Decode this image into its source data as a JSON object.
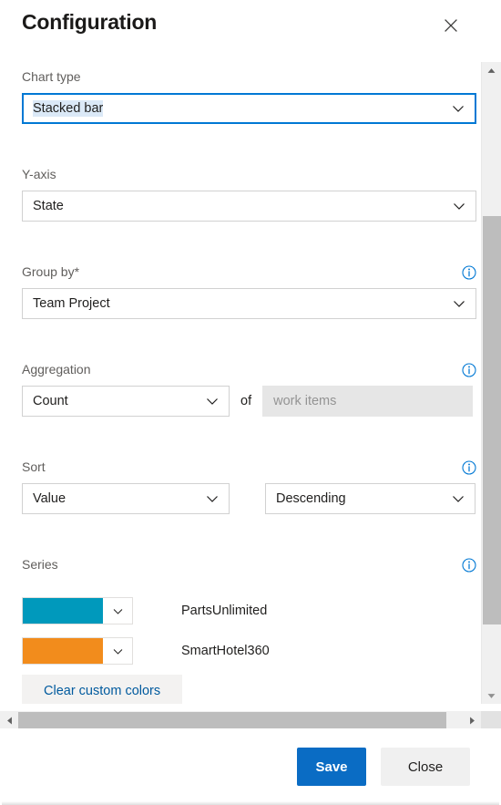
{
  "dialog": {
    "title": "Configuration",
    "close_icon": "close-icon",
    "close_label": "Close"
  },
  "fields": {
    "chart_type": {
      "label": "Chart type",
      "value": "Stacked bar",
      "chevron_icon": "chevron-down-icon",
      "focused": true
    },
    "y_axis": {
      "label": "Y-axis",
      "value": "State",
      "chevron_icon": "chevron-down-icon"
    },
    "group_by": {
      "label": "Group by*",
      "value": "Team Project",
      "chevron_icon": "chevron-down-icon",
      "info_icon": "info-icon"
    },
    "aggregation": {
      "label": "Aggregation",
      "value": "Count",
      "chevron_icon": "chevron-down-icon",
      "info_icon": "info-icon",
      "of_label": "of",
      "target_placeholder": "work items",
      "target_value": ""
    },
    "sort": {
      "label": "Sort",
      "info_icon": "info-icon",
      "by_value": "Value",
      "direction_value": "Descending",
      "chevron_icon": "chevron-down-icon"
    },
    "series": {
      "label": "Series",
      "info_icon": "info-icon",
      "items": [
        {
          "name": "PartsUnlimited",
          "color": "#0099BC",
          "chevron_icon": "chevron-down-icon"
        },
        {
          "name": "SmartHotel360",
          "color": "#F28C1C",
          "chevron_icon": "chevron-down-icon"
        }
      ],
      "clear_colors_label": "Clear custom colors"
    }
  },
  "footer": {
    "save_label": "Save",
    "close_label": "Close"
  },
  "scrollbars": {
    "vertical": {
      "up_arrow_icon": "caret-up-icon",
      "down_arrow_icon": "caret-down-icon",
      "thumb_name": "vertical-scroll-thumb"
    },
    "horizontal": {
      "left_arrow_icon": "caret-left-icon",
      "right_arrow_icon": "caret-right-icon",
      "thumb_name": "horizontal-scroll-thumb"
    }
  },
  "colors": {
    "accent": "#0a6cc4",
    "link": "#005a9e",
    "focus_border": "#0078d4",
    "label_text": "#605e5c",
    "selection_highlight": "#dbe9f7"
  }
}
